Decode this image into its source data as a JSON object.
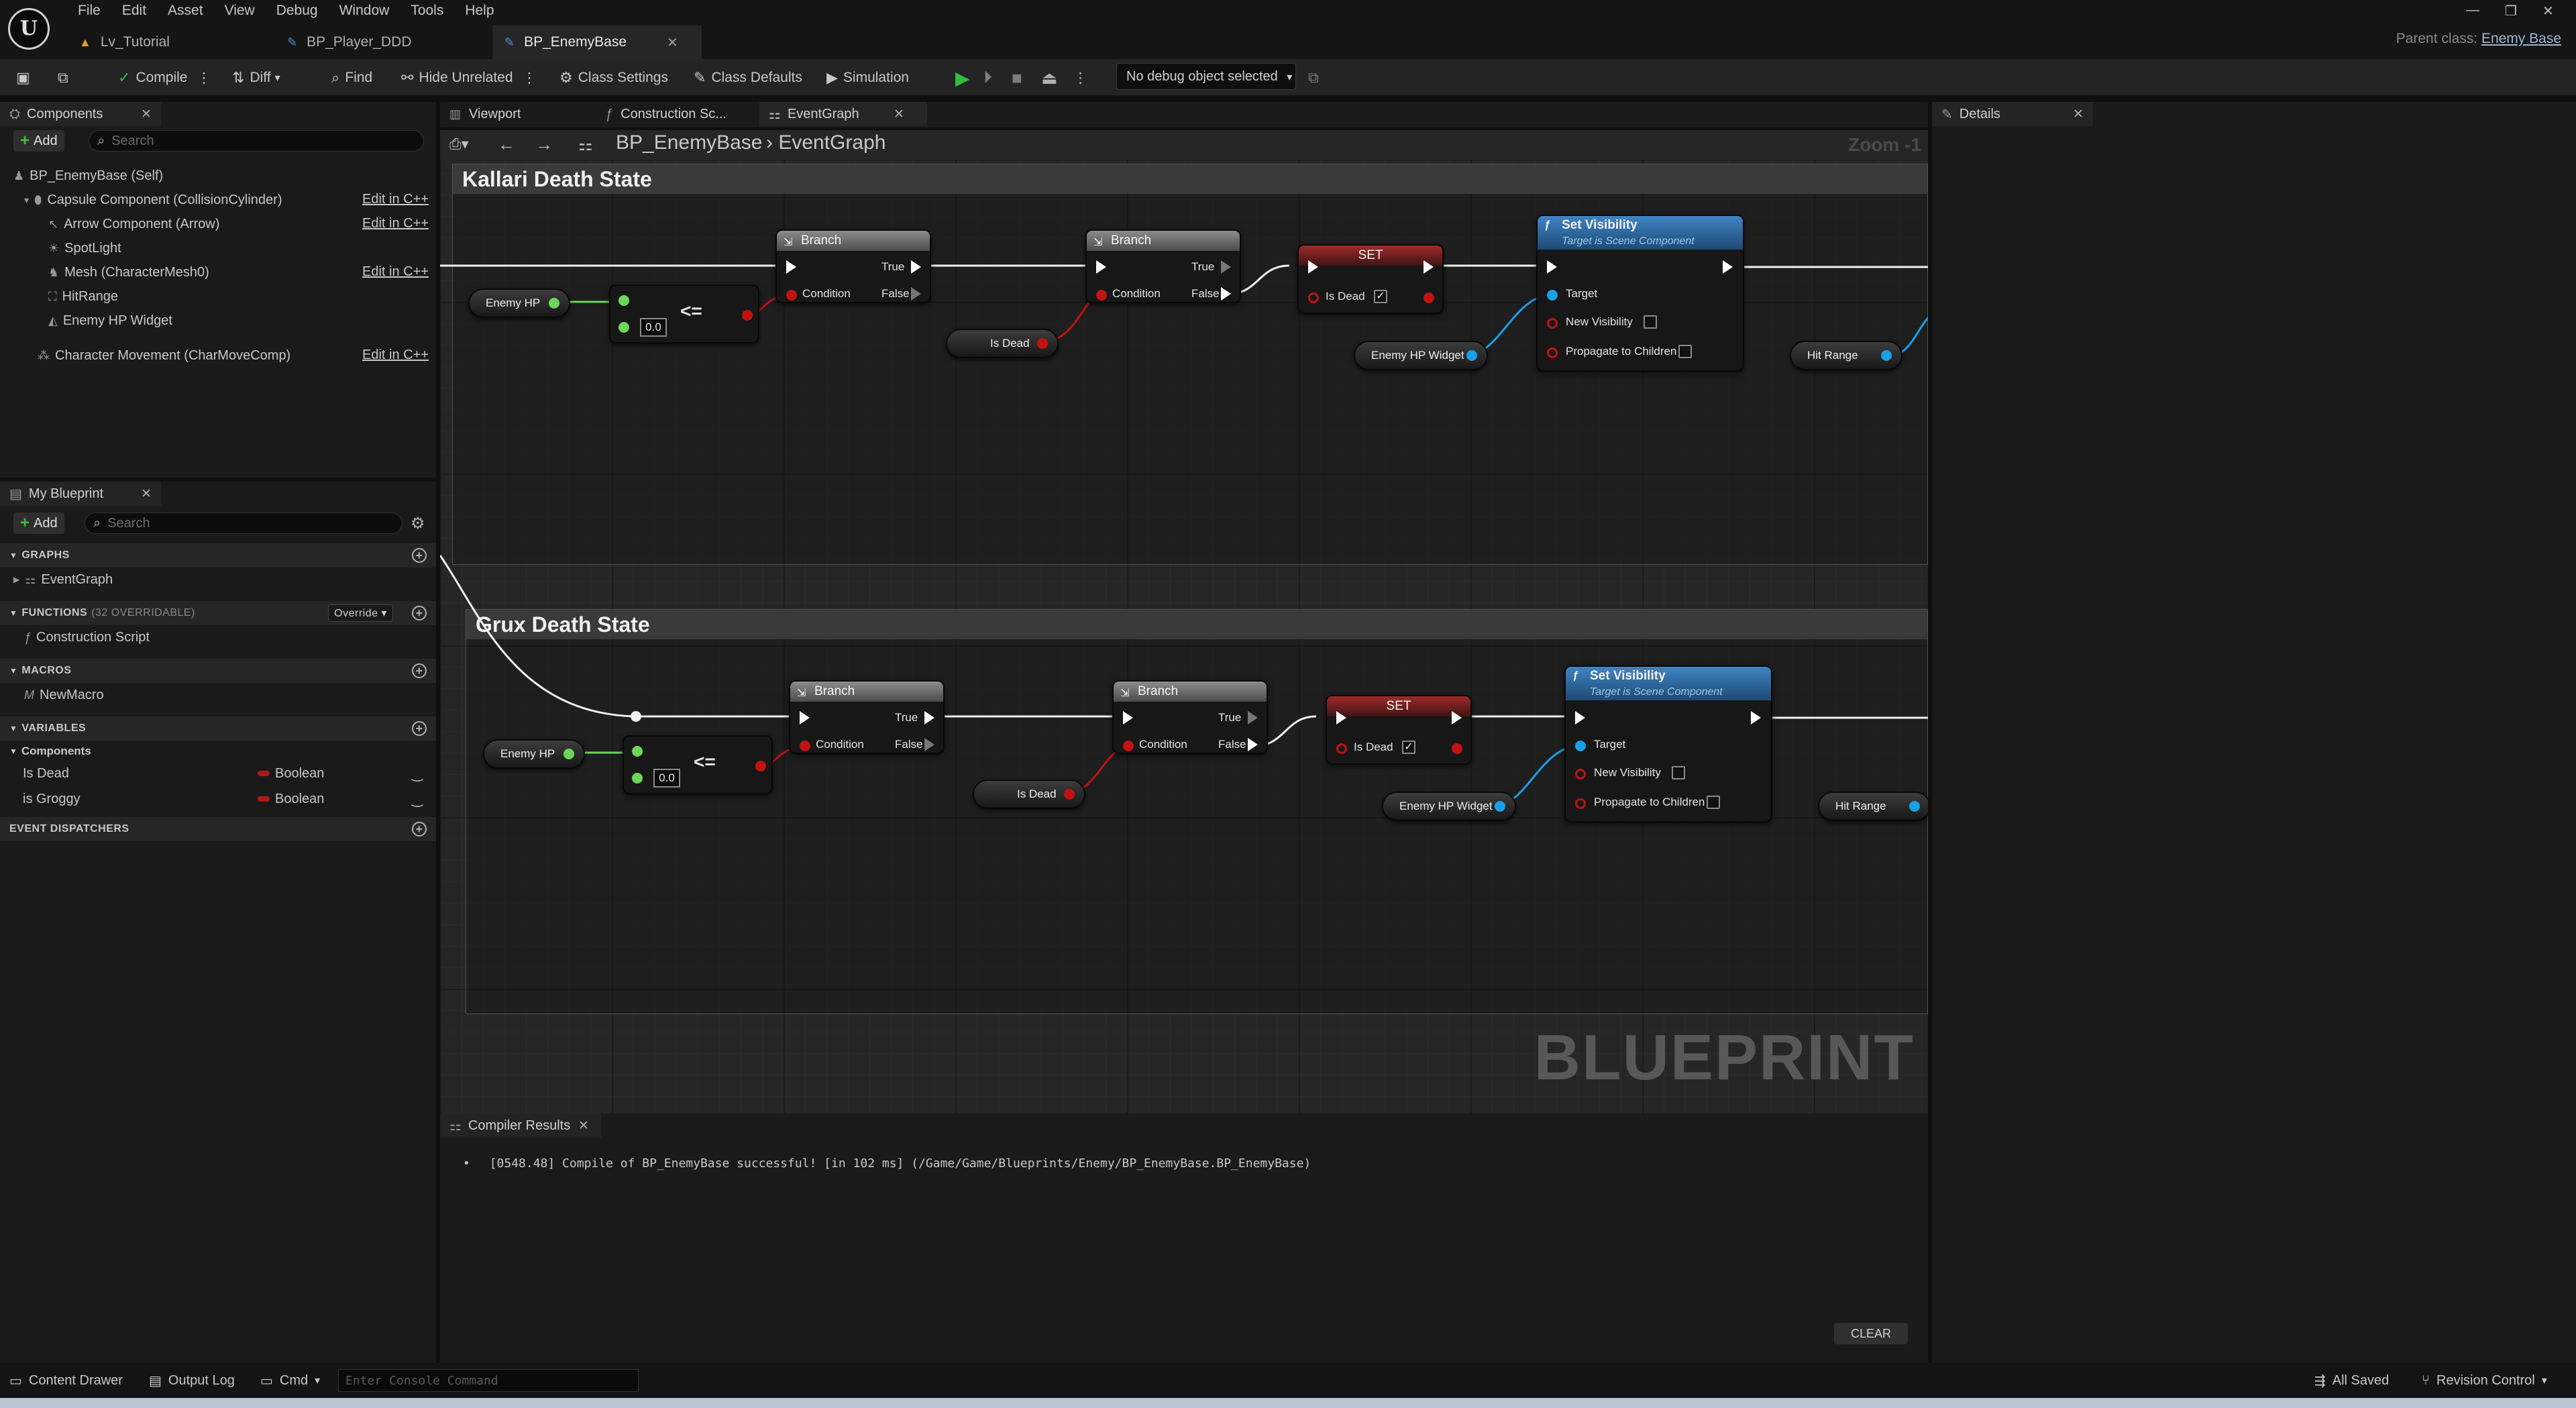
{
  "app": {
    "logo": "U"
  },
  "menu": [
    "File",
    "Edit",
    "Asset",
    "View",
    "Debug",
    "Window",
    "Tools",
    "Help"
  ],
  "doc_tabs": [
    {
      "label": "Lv_Tutorial",
      "icon": "level-icon"
    },
    {
      "label": "BP_Player_DDD",
      "icon": "blueprint-icon"
    },
    {
      "label": "BP_EnemyBase",
      "icon": "blueprint-icon",
      "active": true
    }
  ],
  "parent_class": {
    "prefix": "Parent class:",
    "value": "Enemy Base"
  },
  "toolbar": {
    "compile": "Compile",
    "diff": "Diff",
    "find": "Find",
    "hide_unrelated": "Hide Unrelated",
    "class_settings": "Class Settings",
    "class_defaults": "Class Defaults",
    "simulation": "Simulation",
    "debug_object": "No debug object selected"
  },
  "components": {
    "tab": "Components",
    "add": "Add",
    "search_placeholder": "Search",
    "root": "BP_EnemyBase (Self)",
    "items": [
      {
        "label": "Capsule Component (CollisionCylinder)",
        "edit": "Edit in C++"
      },
      {
        "label": "Arrow Component (Arrow)",
        "edit": "Edit in C++"
      },
      {
        "label": "SpotLight",
        "edit": ""
      },
      {
        "label": "Mesh (CharacterMesh0)",
        "edit": "Edit in C++"
      },
      {
        "label": "HitRange",
        "edit": ""
      },
      {
        "label": "Enemy HP Widget",
        "edit": ""
      }
    ],
    "movement": {
      "label": "Character Movement (CharMoveComp)",
      "edit": "Edit in C++"
    }
  },
  "my_blueprint": {
    "tab": "My Blueprint",
    "add": "Add",
    "search_placeholder": "Search",
    "graphs_header": "GRAPHS",
    "graph_item": "EventGraph",
    "functions_header": "FUNCTIONS",
    "functions_sub": "(32 OVERRIDABLE)",
    "override_label": "Override",
    "function_item": "Construction Script",
    "macros_header": "MACROS",
    "macro_item": "NewMacro",
    "variables_header": "VARIABLES",
    "var_category": "Components",
    "variables": [
      {
        "name": "Is Dead",
        "type": "Boolean"
      },
      {
        "name": "is Groggy",
        "type": "Boolean"
      }
    ],
    "dispatchers_header": "EVENT DISPATCHERS"
  },
  "graph_tabs": [
    {
      "label": "Viewport"
    },
    {
      "label": "Construction Sc..."
    },
    {
      "label": "EventGraph",
      "active": true
    }
  ],
  "breadcrumb": {
    "blueprint": "BP_EnemyBase",
    "graph": "EventGraph"
  },
  "zoom": "Zoom -1",
  "comments": {
    "top": "Kallari Death State",
    "bottom": "Grux Death State"
  },
  "nodes": {
    "enemy_hp": "Enemy HP",
    "lte": "<=",
    "lte_value": "0.0",
    "branch": "Branch",
    "condition": "Condition",
    "true_label": "True",
    "false_label": "False",
    "is_dead": "Is Dead",
    "set": "SET",
    "set_visibility": "Set Visibility",
    "set_visibility_sub": "Target is Scene Component",
    "target": "Target",
    "new_visibility": "New Visibility",
    "propagate": "Propagate to Children",
    "enemy_hp_widget": "Enemy HP Widget",
    "hit_range": "Hit Range"
  },
  "watermark": "BLUEPRINT",
  "details": {
    "tab": "Details"
  },
  "compiler": {
    "tab": "Compiler Results",
    "log": "[0548.48] Compile of BP_EnemyBase successful! [in 102 ms] (/Game/Game/Blueprints/Enemy/BP_EnemyBase.BP_EnemyBase)",
    "clear": "CLEAR"
  },
  "statusbar": {
    "content_drawer": "Content Drawer",
    "output_log": "Output Log",
    "cmd": "Cmd",
    "console_placeholder": "Enter Console Command",
    "all_saved": "All Saved",
    "revision_control": "Revision Control"
  }
}
